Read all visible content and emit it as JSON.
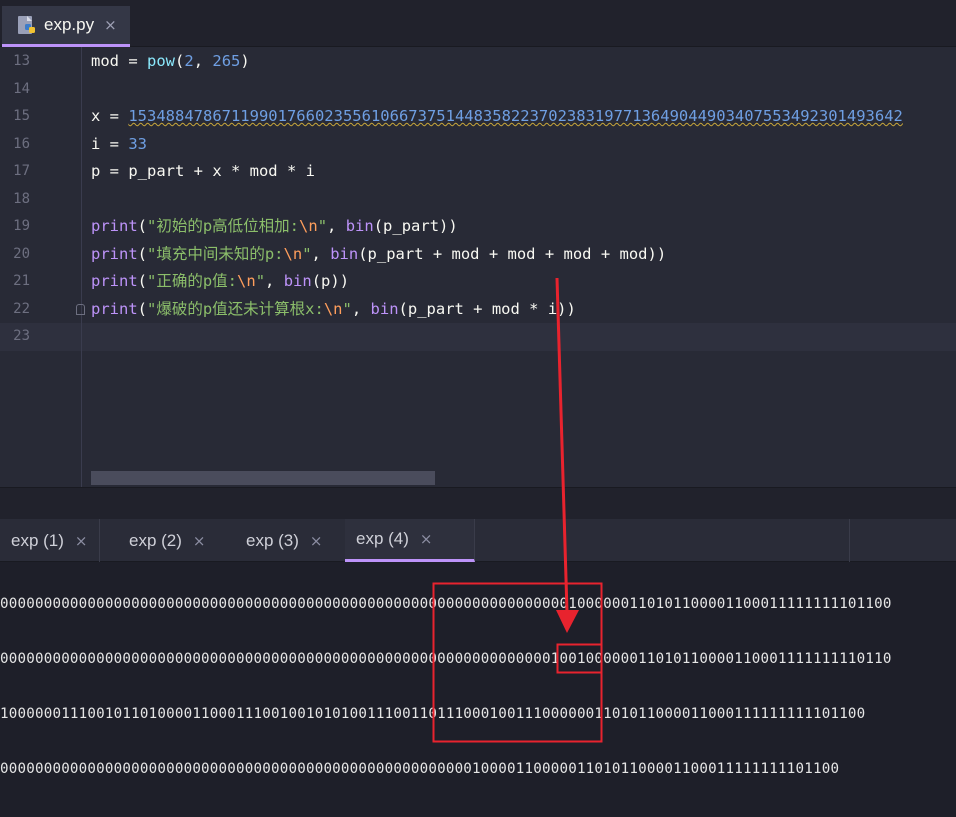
{
  "editor_tab": {
    "filename": "exp.py",
    "close_glyph": "×"
  },
  "gutter": [
    "13",
    "14",
    "15",
    "16",
    "17",
    "18",
    "19",
    "20",
    "21",
    "22",
    "23"
  ],
  "code": {
    "l13": {
      "a": "mod = ",
      "fn": "pow",
      "b": "(",
      "n1": "2",
      "c": ", ",
      "n2": "265",
      "d": ")"
    },
    "l15": {
      "a": "x = ",
      "num": "15348847867119901766023556106673751448358223702383197713649044903407553492301493642"
    },
    "l16": {
      "a": "i = ",
      "num": "33"
    },
    "l17": {
      "a": "p = p_part + x * mod * i"
    },
    "l19": {
      "fn": "print",
      "o": "(",
      "s": "\"初始的p高低位相加:",
      "e": "\\n",
      "q": "\"",
      "c": ", ",
      "fn2": "bin",
      "r": "(p_part))"
    },
    "l20": {
      "fn": "print",
      "o": "(",
      "s": "\"填充中间未知的p:",
      "e": "\\n",
      "q": "\"",
      "c": ", ",
      "fn2": "bin",
      "r": "(p_part + mod + mod + mod + mod))"
    },
    "l21": {
      "fn": "print",
      "o": "(",
      "s": "\"正确的p值:",
      "e": "\\n",
      "q": "\"",
      "c": ", ",
      "fn2": "bin",
      "r": "(p))"
    },
    "l22": {
      "fn": "print",
      "o": "(",
      "s": "\"爆破的p值还未计算根x:",
      "e": "\\n",
      "q": "\"",
      "c": ", ",
      "fn2": "bin",
      "r": "(p_part + mod * i))"
    }
  },
  "run_tabs": [
    {
      "label": "exp (1)",
      "close": "×"
    },
    {
      "label": "exp (2)",
      "close": "×"
    },
    {
      "label": "exp (3)",
      "close": "×"
    },
    {
      "label": "exp (4)",
      "close": "×",
      "active": true
    }
  ],
  "console": [
    "000000000000000000000000000000000000000000000000000000000000000001000000110101100001100011111111101100",
    "000000000000000000000000000000000000000000000000000000000000000100100000011010110000110001111111110110",
    "100000011100101101000011000111001001010100111001101110001001110000001101011000011000111111111101100",
    "000000000000000000000000000000000000000000000000000000100001100000110101100001100011111111101100"
  ],
  "colors": {
    "accent": "#bd93f9",
    "annotation": "#e8232e",
    "number": "#6f9fe3",
    "string": "#8bbe6a"
  }
}
